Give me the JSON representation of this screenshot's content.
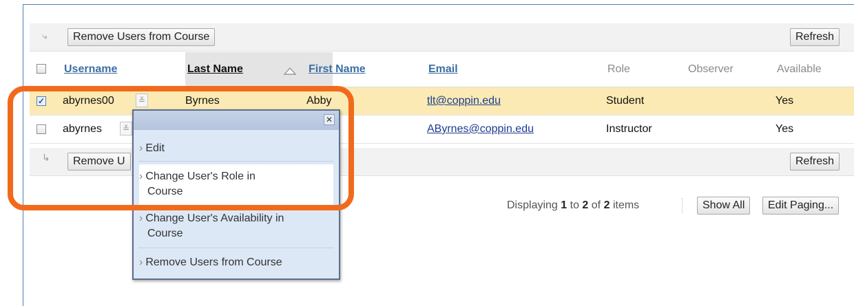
{
  "toolbar_top": {
    "remove_label": "Remove Users from Course",
    "refresh_label": "Refresh"
  },
  "toolbar_bottom": {
    "remove_label_partial": "Remove U",
    "refresh_label": "Refresh"
  },
  "columns": {
    "username": "Username",
    "last_name": "Last Name",
    "first_name": "First Name",
    "email": "Email",
    "role": "Role",
    "observer": "Observer",
    "available": "Available"
  },
  "sorted_column": "last_name",
  "rows": [
    {
      "username": "abyrnes00",
      "last_name": "Byrnes",
      "first_name": "Abby",
      "email": "tlt@coppin.edu",
      "role": "Student",
      "observer": "",
      "available": "Yes",
      "checked": true,
      "highlighted": true
    },
    {
      "username": "abyrnes",
      "last_name": "",
      "first_name": "",
      "email": "AByrnes@coppin.edu",
      "role": "Instructor",
      "observer": "",
      "available": "Yes",
      "checked": false,
      "highlighted": false
    }
  ],
  "context_menu": {
    "close_icon": "close-icon",
    "items": [
      {
        "line1": "Edit",
        "line2": ""
      },
      {
        "line1": "Change User's Role in",
        "line2": "Course"
      },
      {
        "line1": "Change User's Availability in",
        "line2": "Course"
      },
      {
        "line1": "Remove Users from Course",
        "line2": ""
      }
    ],
    "highlighted_index": 1
  },
  "paging": {
    "prefix": "Displaying",
    "from": "1",
    "middle1": "to",
    "to": "2",
    "middle2": "of",
    "total": "2",
    "suffix": "items",
    "show_all_label": "Show All",
    "edit_paging_label": "Edit Paging..."
  },
  "colors": {
    "highlight_row": "#fbeab3",
    "annotation_ring": "#f16a1c",
    "link": "#1a3d8f"
  }
}
